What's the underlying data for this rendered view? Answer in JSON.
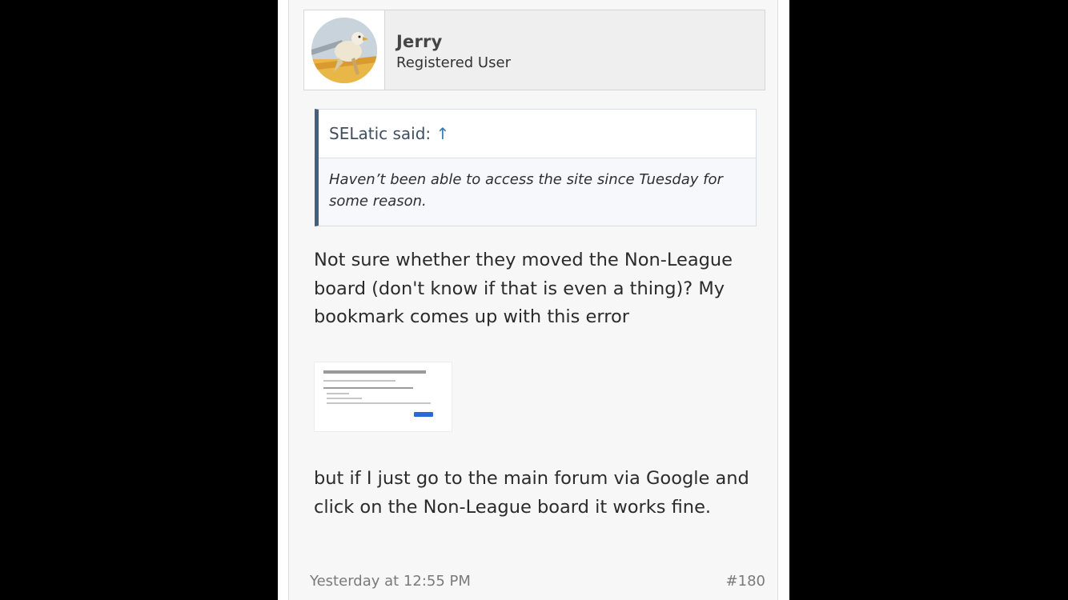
{
  "user": {
    "name": "Jerry",
    "title": "Registered User"
  },
  "quote": {
    "author_label": "SELatic said:",
    "arrow_icon": "up-arrow-icon",
    "body": "Haven’t been able to access the site since Tuesday for some reason."
  },
  "message": {
    "paragraph_1": "Not sure whether they moved the Non-League board (don't know if that is even a thing)? My bookmark comes up with this error",
    "paragraph_2": "but if I just go to the main forum via Google and click on the Non-League board it works fine."
  },
  "footer": {
    "date": "Yesterday at 12:55 PM",
    "post_number": "#180"
  },
  "colors": {
    "quote_border": "#47607a",
    "link": "#3a78b2",
    "background": "#000000"
  }
}
